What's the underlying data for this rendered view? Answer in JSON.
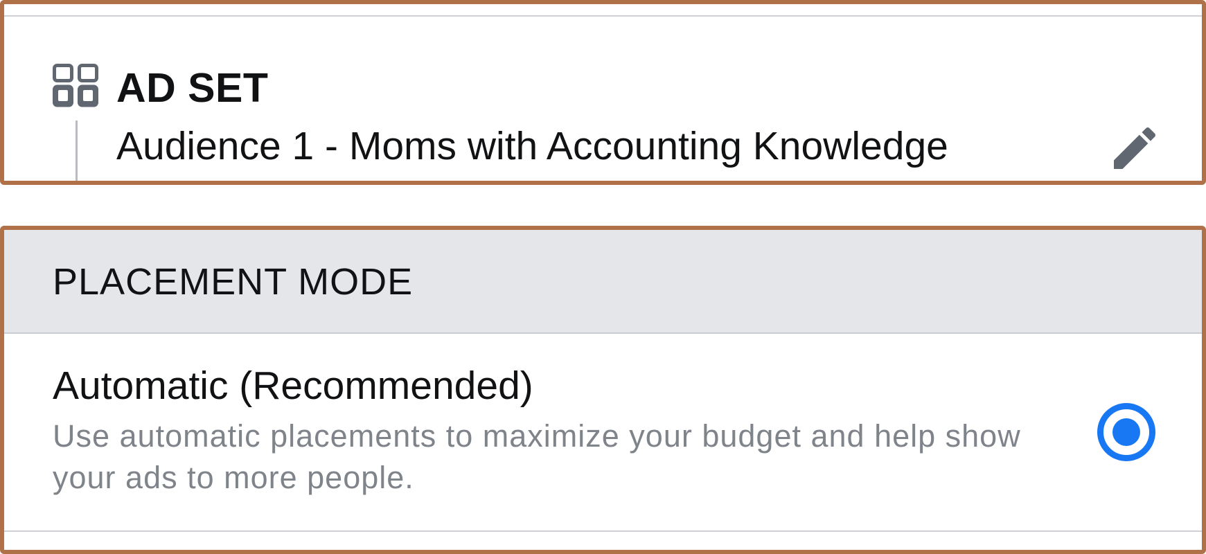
{
  "ad_set": {
    "label": "AD SET",
    "name": "Audience 1 - Moms with Accounting Knowledge",
    "icon": "ad-set-grid-icon",
    "edit_icon": "pencil-icon"
  },
  "placement_mode": {
    "title": "PLACEMENT MODE",
    "options": [
      {
        "title": "Automatic (Recommended)",
        "description": "Use automatic placements to maximize your budget and help show your ads to more people.",
        "selected": true
      }
    ]
  },
  "colors": {
    "frame": "#b07048",
    "accent": "#1877f2",
    "header_bg": "#e4e6ea",
    "secondary_text": "#7f838a",
    "icon_gray": "#606770"
  }
}
